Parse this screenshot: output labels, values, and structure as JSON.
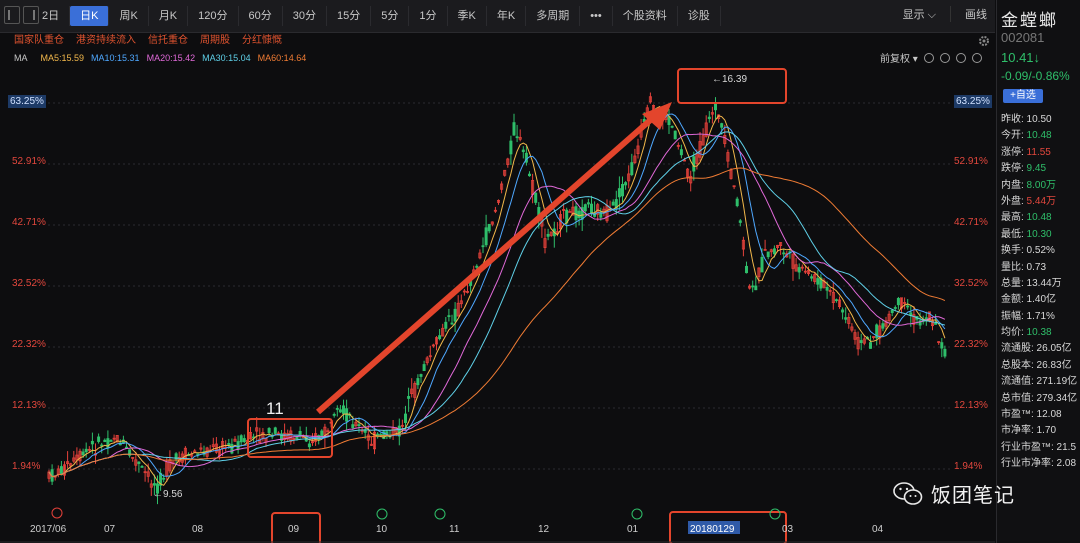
{
  "toolbar": {
    "tabs": [
      "2日",
      "日K",
      "周K",
      "月K",
      "120分",
      "60分",
      "30分",
      "15分",
      "5分",
      "1分",
      "季K",
      "年K",
      "多周期",
      "•••",
      "个股资料",
      "诊股"
    ],
    "active_index": 1,
    "right": {
      "display": "显示",
      "draw": "画线"
    }
  },
  "badges": [
    "国家队重仓",
    "港资持续流入",
    "信托重仓",
    "周期股",
    "分红慷慨"
  ],
  "ma": {
    "label": "MA",
    "items": [
      {
        "text": "MA5:15.59",
        "color": "#f2b84b"
      },
      {
        "text": "MA10:15.31",
        "color": "#4fa8ff"
      },
      {
        "text": "MA20:15.42",
        "color": "#e069d8"
      },
      {
        "text": "MA30:15.04",
        "color": "#5fd0e8"
      },
      {
        "text": "MA60:14.64",
        "color": "#f07c34"
      }
    ],
    "adjust": "前复权"
  },
  "axis": {
    "left_pct": [
      "63.25%",
      "52.91%",
      "42.71%",
      "32.52%",
      "22.32%",
      "12.13%",
      "1.94%"
    ],
    "right_pct": [
      "63.25%",
      "52.91%",
      "42.71%",
      "32.52%",
      "22.32%",
      "12.13%",
      "1.94%"
    ],
    "x_labels": [
      "2017/06",
      "07",
      "08",
      "09",
      "10",
      "11",
      "12",
      "01",
      "20180129",
      "03",
      "04"
    ]
  },
  "annotations": {
    "high": "←16.39",
    "low": "←9.56",
    "box_label": "11"
  },
  "sidebar": {
    "name": "金螳螂",
    "code": "002081",
    "price": "10.41↓",
    "change": "-0.09/-0.86%",
    "add_btn": "+自选",
    "stats": [
      {
        "k": "昨收:",
        "v": "10.50",
        "c": "white"
      },
      {
        "k": "今开:",
        "v": "10.48",
        "c": "green"
      },
      {
        "k": "涨停:",
        "v": "11.55",
        "c": "red"
      },
      {
        "k": "跌停:",
        "v": "9.45",
        "c": "green"
      },
      {
        "k": "内盘:",
        "v": "8.00万",
        "c": "green"
      },
      {
        "k": "外盘:",
        "v": "5.44万",
        "c": "red"
      },
      {
        "k": "最高:",
        "v": "10.48",
        "c": "green"
      },
      {
        "k": "最低:",
        "v": "10.30",
        "c": "green"
      },
      {
        "k": "换手:",
        "v": "0.52%",
        "c": "white"
      },
      {
        "k": "量比:",
        "v": "0.73",
        "c": "white"
      },
      {
        "k": "总量:",
        "v": "13.44万",
        "c": "white"
      },
      {
        "k": "金额:",
        "v": "1.40亿",
        "c": "white"
      },
      {
        "k": "振幅:",
        "v": "1.71%",
        "c": "white"
      },
      {
        "k": "均价:",
        "v": "10.38",
        "c": "green"
      },
      {
        "k": "流通股:",
        "v": "26.05亿",
        "c": "white"
      },
      {
        "k": "总股本:",
        "v": "26.83亿",
        "c": "white"
      },
      {
        "k": "流通值:",
        "v": "271.19亿",
        "c": "white"
      },
      {
        "k": "总市值:",
        "v": "279.34亿",
        "c": "white"
      },
      {
        "k": "市盈™:",
        "v": "12.08",
        "c": "white"
      },
      {
        "k": "市净率:",
        "v": "1.70",
        "c": "white"
      },
      {
        "k": "行业市盈™:",
        "v": "21.5",
        "c": "white"
      },
      {
        "k": "行业市净率:",
        "v": "2.08",
        "c": "white"
      }
    ]
  },
  "watermark": "饭团笔记"
}
